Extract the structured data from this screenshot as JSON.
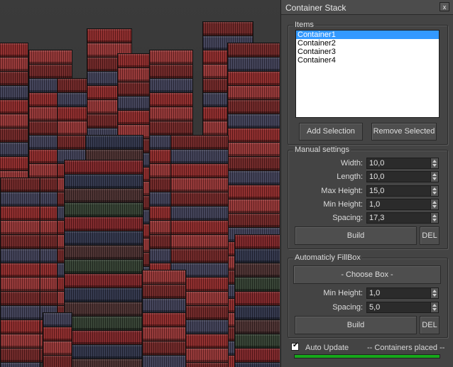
{
  "window": {
    "title": "Container Stack",
    "close_label": "x"
  },
  "items": {
    "label": "Items",
    "list": [
      {
        "label": "Container1",
        "selected": true
      },
      {
        "label": "Container2",
        "selected": false
      },
      {
        "label": "Container3",
        "selected": false
      },
      {
        "label": "Container4",
        "selected": false
      }
    ],
    "add_label": "Add Selection",
    "remove_label": "Remove Selected"
  },
  "manual": {
    "label": "Manual settings",
    "width_label": "Width:",
    "width_value": "10,0",
    "length_label": "Length:",
    "length_value": "10,0",
    "max_height_label": "Max Height:",
    "max_height_value": "15,0",
    "min_height_label": "Min Height:",
    "min_height_value": "1,0",
    "spacing_label": "Spacing:",
    "spacing_value": "17,3",
    "build_label": "Build",
    "del_label": "DEL"
  },
  "autofill": {
    "label": "Automaticly FillBox",
    "choose_label": "- Choose Box -",
    "min_height_label": "Min Height:",
    "min_height_value": "1,0",
    "spacing_label": "Spacing:",
    "spacing_value": "5,0",
    "build_label": "Build",
    "del_label": "DEL"
  },
  "footer": {
    "auto_update_label": "Auto Update",
    "auto_update_checked": true,
    "status": "-- Containers placed --",
    "progress": 1.0
  },
  "colors": {
    "accent": "#3399ff",
    "progress": "#16a81a",
    "panel": "#444444"
  }
}
